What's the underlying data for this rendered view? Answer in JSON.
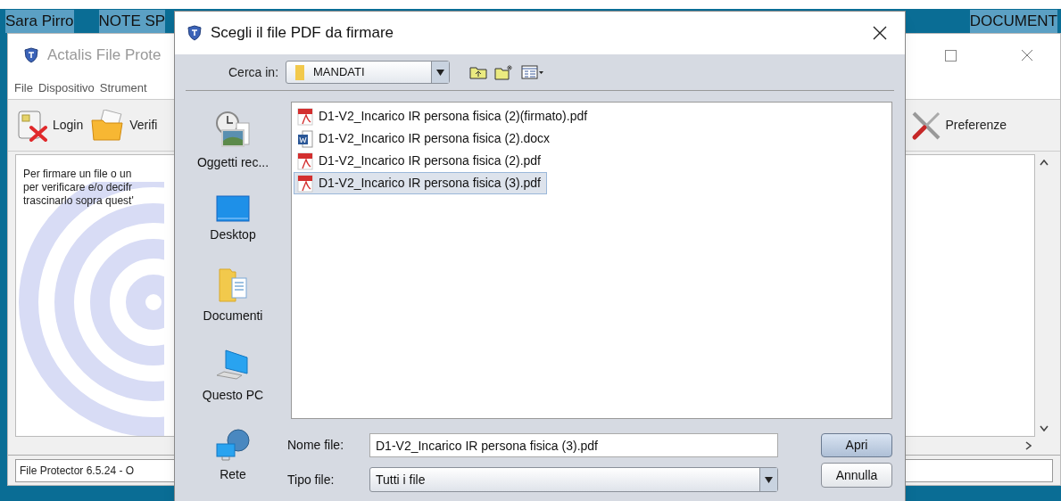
{
  "desktop": {
    "labels": [
      "Sara Pirro",
      "NOTE SP",
      "DOCUMENT"
    ]
  },
  "main_window": {
    "title": "Actalis File Prote",
    "menu": [
      "File",
      "Dispositivo",
      "Strument"
    ],
    "toolbar": [
      {
        "label": "Login",
        "kind": "login"
      },
      {
        "label": "Verifi",
        "kind": "verify"
      },
      {
        "label": "Preferenze",
        "kind": "preferences"
      }
    ],
    "message_lines": [
      "Per firmare un file o un",
      "per verificare e/o decifr",
      "trascinarlo sopra quest'"
    ],
    "status": "File Protector 6.5.24 - O"
  },
  "dialog": {
    "title": "Scegli il file PDF da firmare",
    "look_in": {
      "label": "Cerca in:",
      "value": "MANDATI"
    },
    "places": [
      {
        "label": "Oggetti rec...",
        "kind": "recent"
      },
      {
        "label": "Desktop",
        "kind": "desktop"
      },
      {
        "label": "Documenti",
        "kind": "documents"
      },
      {
        "label": "Questo PC",
        "kind": "computer"
      },
      {
        "label": "Rete",
        "kind": "network"
      }
    ],
    "files": [
      {
        "name": "D1-V2_Incarico IR persona fisica (2)(firmato).pdf",
        "kind": "pdf",
        "selected": false
      },
      {
        "name": "D1-V2_Incarico IR persona fisica (2).docx",
        "kind": "word",
        "selected": false
      },
      {
        "name": "D1-V2_Incarico IR persona fisica (2).pdf",
        "kind": "pdf",
        "selected": false
      },
      {
        "name": "D1-V2_Incarico IR persona fisica (3).pdf",
        "kind": "pdf",
        "selected": true
      }
    ],
    "file_name": {
      "label": "Nome file:",
      "value": "D1-V2_Incarico IR persona fisica (3).pdf"
    },
    "file_type": {
      "label": "Tipo file:",
      "value": "Tutti i file"
    },
    "buttons": [
      "Apri",
      "Annulla"
    ]
  }
}
